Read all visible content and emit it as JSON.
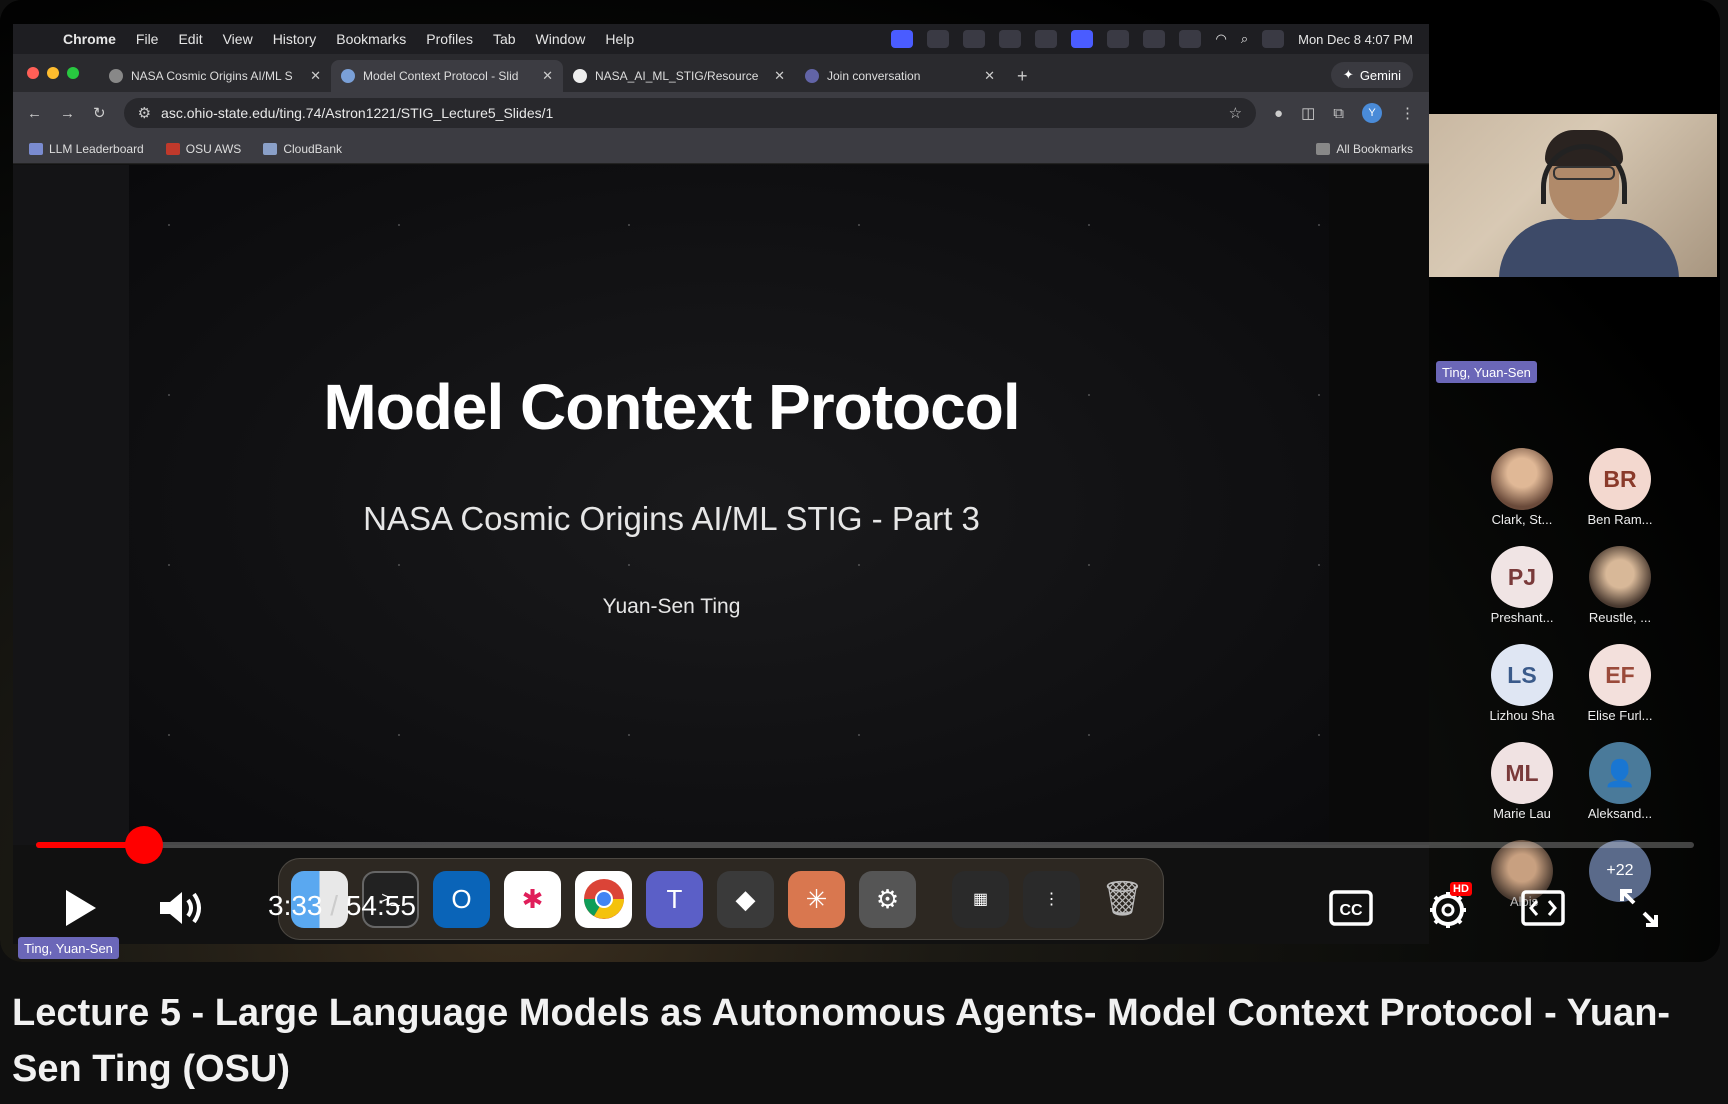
{
  "menubar": {
    "app": "Chrome",
    "items": [
      "File",
      "Edit",
      "View",
      "History",
      "Bookmarks",
      "Profiles",
      "Tab",
      "Window",
      "Help"
    ],
    "clock": "Mon Dec 8  4:07 PM"
  },
  "browser": {
    "tabs": [
      {
        "label": "NASA Cosmic Origins AI/ML S",
        "active": false
      },
      {
        "label": "Model Context Protocol - Slid",
        "active": true
      },
      {
        "label": "NASA_AI_ML_STIG/Resource",
        "active": false
      },
      {
        "label": "Join conversation",
        "active": false
      }
    ],
    "gemini_label": "Gemini",
    "url": "asc.ohio-state.edu/ting.74/Astron1221/STIG_Lecture5_Slides/1",
    "profile_initial": "Y",
    "bookmarks": [
      "LLM Leaderboard",
      "OSU AWS",
      "CloudBank"
    ],
    "all_bookmarks": "All Bookmarks"
  },
  "slide": {
    "title": "Model Context Protocol",
    "subtitle": "NASA Cosmic Origins AI/ML STIG - Part 3",
    "author": "Yuan-Sen Ting"
  },
  "speaker": {
    "name": "Ting, Yuan-Sen"
  },
  "participants": [
    {
      "initials": "",
      "name": "Clark, St...",
      "color": "#b88a6a",
      "photo": true
    },
    {
      "initials": "BR",
      "name": "Ben Ram...",
      "color": "#f3d8cf",
      "text_color": "#8a3a2a"
    },
    {
      "initials": "PJ",
      "name": "Preshant...",
      "color": "#f0e4e4",
      "text_color": "#7a3a3a"
    },
    {
      "initials": "",
      "name": "Reustle, ...",
      "color": "#8a7a6a",
      "photo": true
    },
    {
      "initials": "LS",
      "name": "Lizhou Sha",
      "color": "#dfe6f3",
      "text_color": "#3a5a8a"
    },
    {
      "initials": "EF",
      "name": "Elise Furl...",
      "color": "#f3e0dc",
      "text_color": "#9a4a3a"
    },
    {
      "initials": "ML",
      "name": "Marie Lau",
      "color": "#f0e2e2",
      "text_color": "#7a3a3a"
    },
    {
      "initials": "",
      "name": "Aleksand...",
      "color": "#4a7a9a",
      "icon": "person-icon"
    },
    {
      "initials": "",
      "name": "Alois",
      "color": "#8a6a5a",
      "photo": true
    },
    {
      "initials": "+22",
      "name": "",
      "color": "#5a6a8a",
      "text_color": "#ffffff"
    }
  ],
  "player": {
    "current_time": "3:33",
    "separator": "/",
    "duration": "54:55",
    "progress_fraction": 0.065,
    "quality_badge": "HD",
    "speaker_tag": "Ting, Yuan-Sen"
  },
  "video_title": "Lecture 5 - Large Language Models as Autonomous Agents- Model Context Protocol - Yuan-Sen Ting (OSU)"
}
